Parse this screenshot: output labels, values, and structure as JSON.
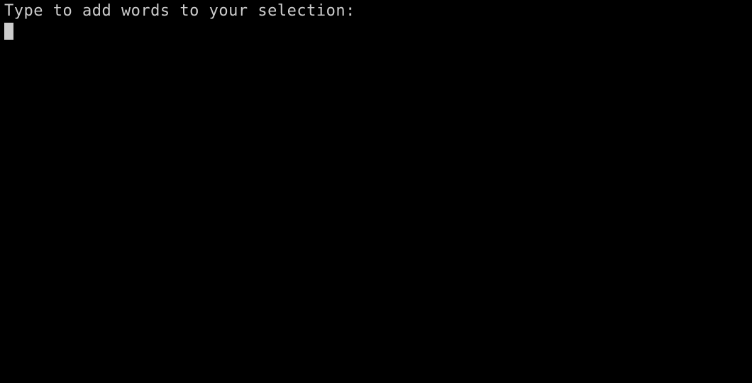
{
  "prompt": {
    "text": "Type to add words to your selection:"
  },
  "input": {
    "value": ""
  }
}
